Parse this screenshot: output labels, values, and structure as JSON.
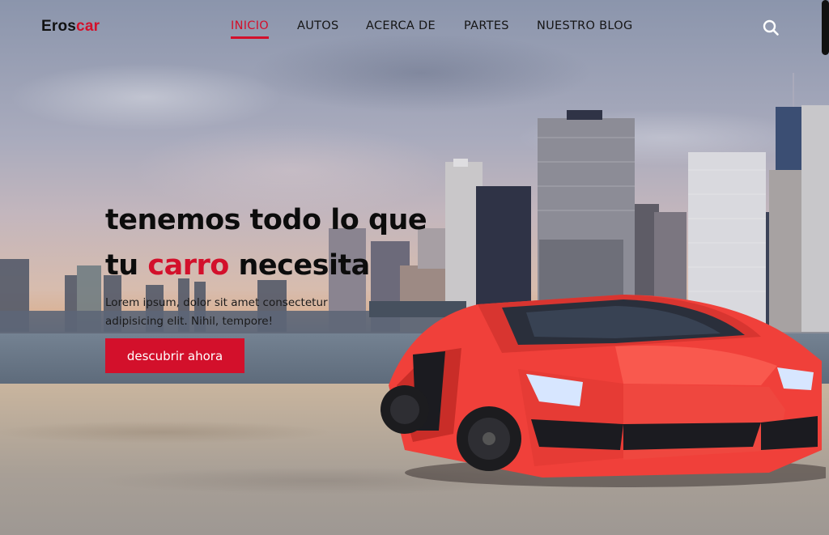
{
  "brand": {
    "part1": "Eros",
    "part2": "car"
  },
  "nav": {
    "items": [
      {
        "label": "INICIO",
        "active": true
      },
      {
        "label": "AUTOS",
        "active": false
      },
      {
        "label": "ACERCA DE",
        "active": false
      },
      {
        "label": "PARTES",
        "active": false
      },
      {
        "label": "NUESTRO BLOG",
        "active": false
      }
    ],
    "search_icon": "search-icon"
  },
  "hero": {
    "headline_line1": "tenemos todo lo que",
    "headline_line2_prefix": "tu ",
    "headline_line2_highlight": "carro",
    "headline_line2_suffix": " necesita",
    "description": "Lorem ipsum, dolor sit amet consectetur adipisicing elit. Nihil, tempore!",
    "cta_label": "descubrir ahora",
    "background_image": "red sports car in front of city skyline"
  },
  "colors": {
    "accent": "#d3102b",
    "text": "#111111",
    "button_text": "#ffffff"
  }
}
